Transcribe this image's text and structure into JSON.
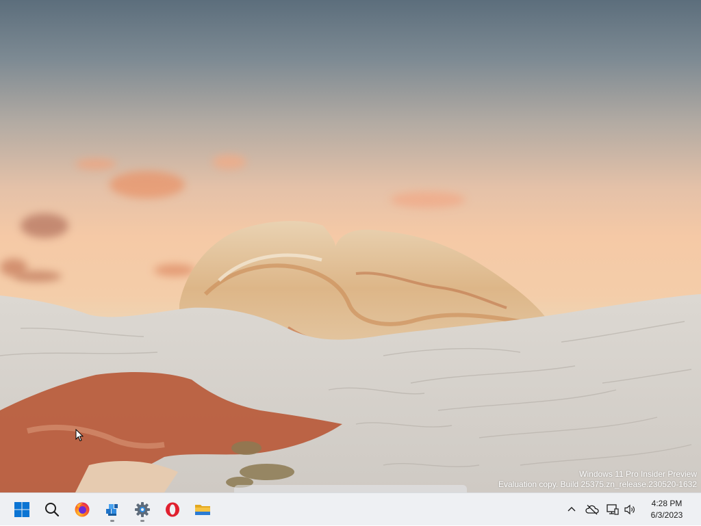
{
  "desktop": {
    "wallpaper": "desert-rock-sunset",
    "watermark": {
      "line1": "Windows 11 Pro Insider Preview",
      "line2": "Evaluation copy. Build 25375.zn_release.230520-1632"
    }
  },
  "taskbar": {
    "background": "#eef0f3",
    "apps": [
      {
        "name": "start",
        "icon": "windows-logo-icon",
        "running": false
      },
      {
        "name": "search",
        "icon": "search-icon",
        "running": false
      },
      {
        "name": "firefox",
        "icon": "firefox-icon",
        "running": false
      },
      {
        "name": "app-package",
        "icon": "package-cubes-icon",
        "running": true
      },
      {
        "name": "settings",
        "icon": "gear-icon",
        "running": true
      },
      {
        "name": "opera",
        "icon": "opera-icon",
        "running": false
      },
      {
        "name": "file-explorer",
        "icon": "folder-icon",
        "running": false
      }
    ]
  },
  "tray": {
    "icons": [
      "chevron-up-icon",
      "cloud-off-icon",
      "network-icon",
      "volume-icon"
    ],
    "time": "4:28 PM",
    "date": "6/3/2023"
  },
  "colors": {
    "windows_blue": "#0078d4",
    "opera_red": "#e0202f",
    "folder_yellow": "#f6c342"
  }
}
